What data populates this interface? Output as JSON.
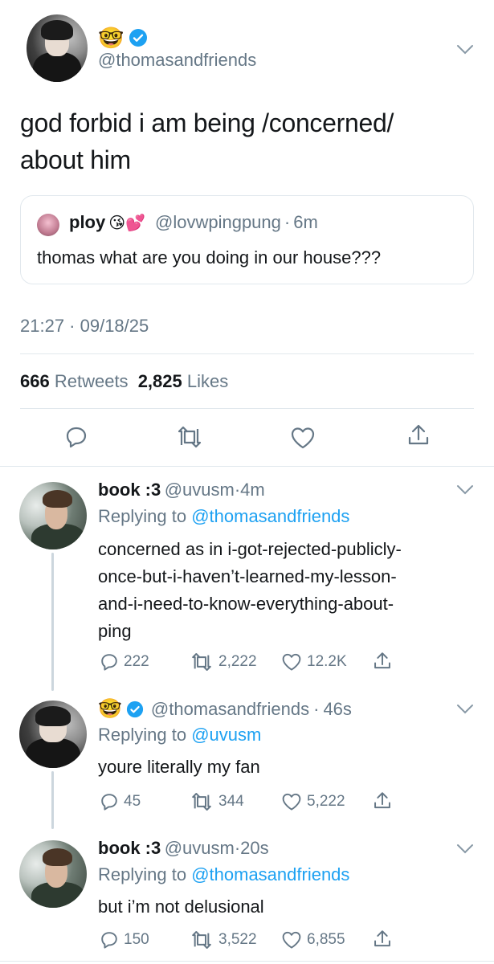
{
  "main_tweet": {
    "handle": "@thomasandfriends",
    "emoji": "🤓",
    "text_line1": "god forbid i am being /concerned/",
    "text_line2": "about him",
    "quote": {
      "name": "ploy",
      "emojis": "😘💕",
      "handle": "@lovwpingpung",
      "time": "6m",
      "text": "thomas what are you doing in our house???"
    },
    "timestamp": "21:27 · 09/18/25",
    "retweets_count": "666",
    "retweets_label": "Retweets",
    "likes_count": "2,825",
    "likes_label": "Likes"
  },
  "replies": [
    {
      "name": "book :3",
      "handle": "@uvusm",
      "time": "4m",
      "replying_prefix": "Replying to",
      "replying_to": "@thomasandfriends",
      "lines": [
        "concerned as in i-got-rejected-publicly-",
        "once-but-i-haven’t-learned-my-lesson-",
        "and-i-need-to-know-everything-about-",
        "ping"
      ],
      "replies": "222",
      "retweets": "2,222",
      "likes": "12.2K"
    },
    {
      "name": "",
      "emoji": "🤓",
      "handle": "@thomasandfriends",
      "time": "46s",
      "replying_prefix": "Replying to",
      "replying_to": "@uvusm",
      "lines": [
        "youre literally my fan"
      ],
      "replies": "45",
      "retweets": "344",
      "likes": "5,222"
    },
    {
      "name": "book :3",
      "handle": "@uvusm",
      "time": "20s",
      "replying_prefix": "Replying to",
      "replying_to": "@thomasandfriends",
      "lines": [
        "but i’m not delusional"
      ],
      "replies": "150",
      "retweets": "3,522",
      "likes": "6,855"
    }
  ],
  "colors": {
    "accent": "#1da1f2",
    "muted": "#657786",
    "divider": "#e1e8ed"
  }
}
